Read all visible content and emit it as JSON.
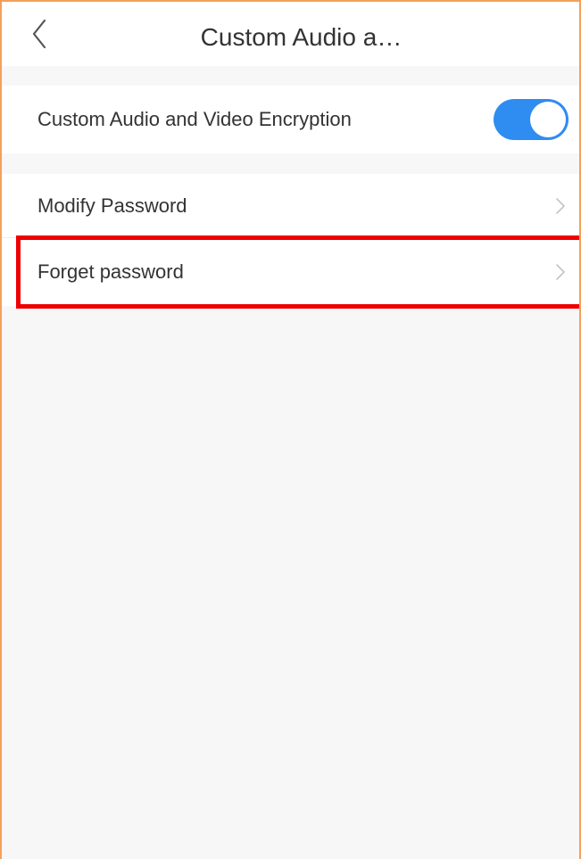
{
  "header": {
    "title": "Custom Audio a…",
    "back_icon": "chevron-left-icon"
  },
  "settings": {
    "encryption": {
      "label": "Custom Audio and Video Encryption",
      "enabled": true
    },
    "modify_password": {
      "label": "Modify Password",
      "icon": "chevron-right-icon"
    },
    "forget_password": {
      "label": "Forget password",
      "icon": "chevron-right-icon"
    }
  },
  "colors": {
    "toggle_on": "#2f8cf0",
    "highlight": "#ee0000",
    "frame_border": "#f5a05a",
    "background": "#f7f7f7"
  }
}
